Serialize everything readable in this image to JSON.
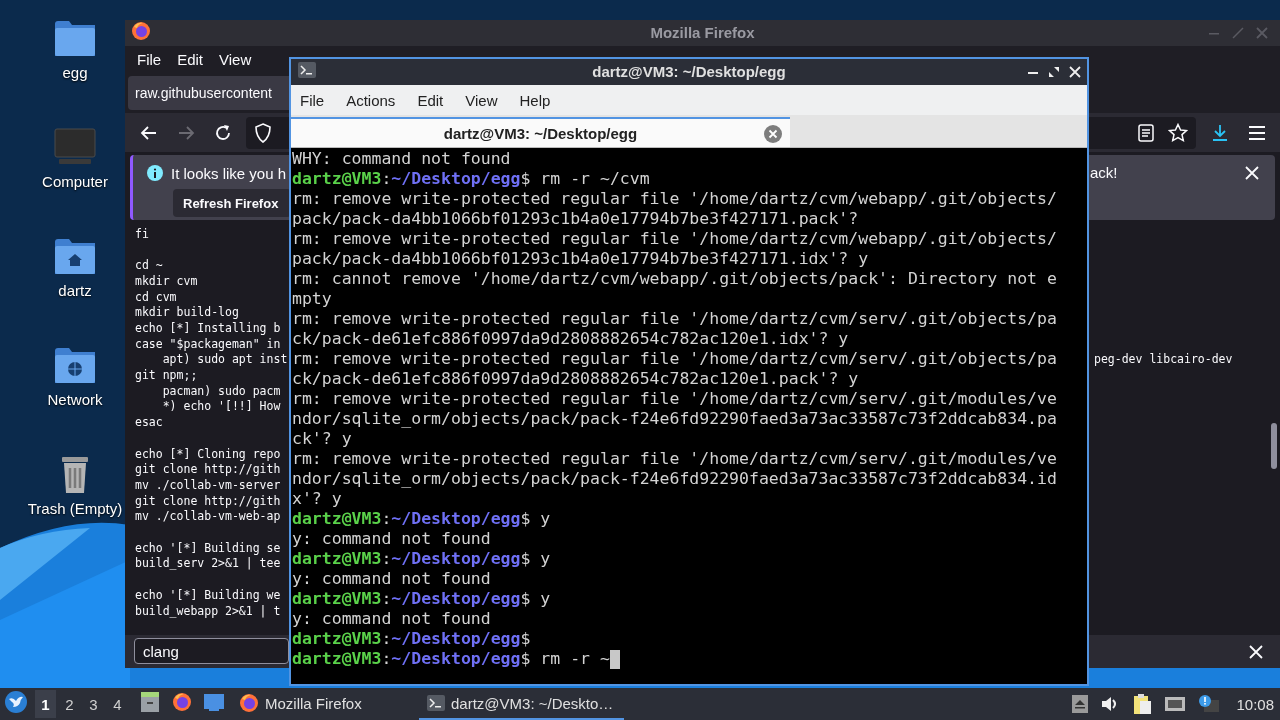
{
  "desktop_icons": [
    {
      "label": "egg",
      "kind": "folder"
    },
    {
      "label": "Computer",
      "kind": "computer"
    },
    {
      "label": "dartz",
      "kind": "home"
    },
    {
      "label": "Network",
      "kind": "network"
    },
    {
      "label": "Trash (Empty)",
      "kind": "trash"
    }
  ],
  "firefox": {
    "title": "Mozilla Firefox",
    "menu": [
      "File",
      "Edit",
      "View"
    ],
    "tab": {
      "label": "raw.githubusercontent"
    },
    "notification": {
      "message": "It looks like you h",
      "message_end": "ack!",
      "button": "Refresh Firefox"
    },
    "code_blocks": [
      [
        "fi"
      ],
      [
        "cd ~",
        "mkdir cvm",
        "cd cvm",
        "mkdir build-log",
        "echo [*] Installing b",
        "case \"$packageman\" in",
        "    apt) sudo apt inst",
        "git npm;;",
        "    pacman) sudo pacm",
        "    *) echo '[!!] How",
        "esac"
      ],
      [
        "echo [*] Cloning repo",
        "git clone http://gith",
        "mv ./collab-vm-server",
        "git clone http://gith",
        "mv ./collab-vm-web-ap"
      ],
      [
        "echo '[*] Building se",
        "build_serv 2>&1 | tee"
      ],
      [
        "echo '[*] Building we",
        "build_webapp 2>&1 | t"
      ]
    ],
    "code_fragment": "peg-dev libcairo-dev",
    "find": {
      "value": "clang"
    }
  },
  "terminal": {
    "title": "dartz@VM3: ~/Desktop/egg",
    "menu": [
      "File",
      "Actions",
      "Edit",
      "View",
      "Help"
    ],
    "tab": {
      "label": "dartz@VM3: ~/Desktop/egg",
      "selected": true
    },
    "cursor": true,
    "lines": [
      {
        "segments": [
          {
            "kind": "plain",
            "text": "WHY: command not found"
          }
        ]
      },
      {
        "segments": [
          {
            "kind": "user",
            "text": "dartz@VM3"
          },
          {
            "kind": "plain",
            "text": ":"
          },
          {
            "kind": "path",
            "text": "~/Desktop/egg"
          },
          {
            "kind": "plain",
            "text": "$ rm -r ~/cvm"
          }
        ]
      },
      {
        "segments": [
          {
            "kind": "plain",
            "text": "rm: remove write-protected regular file '/home/dartz/cvm/webapp/.git/objects/"
          }
        ]
      },
      {
        "segments": [
          {
            "kind": "plain",
            "text": "pack/pack-da4bb1066bf01293c1b4a0e17794b7be3f427171.pack'?"
          }
        ]
      },
      {
        "segments": [
          {
            "kind": "plain",
            "text": "rm: remove write-protected regular file '/home/dartz/cvm/webapp/.git/objects/"
          }
        ]
      },
      {
        "segments": [
          {
            "kind": "plain",
            "text": "pack/pack-da4bb1066bf01293c1b4a0e17794b7be3f427171.idx'? y"
          }
        ]
      },
      {
        "segments": [
          {
            "kind": "plain",
            "text": "rm: cannot remove '/home/dartz/cvm/webapp/.git/objects/pack': Directory not e"
          }
        ]
      },
      {
        "segments": [
          {
            "kind": "plain",
            "text": "mpty"
          }
        ]
      },
      {
        "segments": [
          {
            "kind": "plain",
            "text": "rm: remove write-protected regular file '/home/dartz/cvm/serv/.git/objects/pa"
          }
        ]
      },
      {
        "segments": [
          {
            "kind": "plain",
            "text": "ck/pack-de61efc886f0997da9d2808882654c782ac120e1.idx'? y"
          }
        ]
      },
      {
        "segments": [
          {
            "kind": "plain",
            "text": "rm: remove write-protected regular file '/home/dartz/cvm/serv/.git/objects/pa"
          }
        ]
      },
      {
        "segments": [
          {
            "kind": "plain",
            "text": "ck/pack-de61efc886f0997da9d2808882654c782ac120e1.pack'? y"
          }
        ]
      },
      {
        "segments": [
          {
            "kind": "plain",
            "text": "rm: remove write-protected regular file '/home/dartz/cvm/serv/.git/modules/ve"
          }
        ]
      },
      {
        "segments": [
          {
            "kind": "plain",
            "text": "ndor/sqlite_orm/objects/pack/pack-f24e6fd92290faed3a73ac33587c73f2ddcab834.pa"
          }
        ]
      },
      {
        "segments": [
          {
            "kind": "plain",
            "text": "ck'? y"
          }
        ]
      },
      {
        "segments": [
          {
            "kind": "plain",
            "text": "rm: remove write-protected regular file '/home/dartz/cvm/serv/.git/modules/ve"
          }
        ]
      },
      {
        "segments": [
          {
            "kind": "plain",
            "text": "ndor/sqlite_orm/objects/pack/pack-f24e6fd92290faed3a73ac33587c73f2ddcab834.id"
          }
        ]
      },
      {
        "segments": [
          {
            "kind": "plain",
            "text": "x'? y"
          }
        ]
      },
      {
        "segments": [
          {
            "kind": "user",
            "text": "dartz@VM3"
          },
          {
            "kind": "plain",
            "text": ":"
          },
          {
            "kind": "path",
            "text": "~/Desktop/egg"
          },
          {
            "kind": "plain",
            "text": "$ y"
          }
        ]
      },
      {
        "segments": [
          {
            "kind": "plain",
            "text": "y: command not found"
          }
        ]
      },
      {
        "segments": [
          {
            "kind": "user",
            "text": "dartz@VM3"
          },
          {
            "kind": "plain",
            "text": ":"
          },
          {
            "kind": "path",
            "text": "~/Desktop/egg"
          },
          {
            "kind": "plain",
            "text": "$ y"
          }
        ]
      },
      {
        "segments": [
          {
            "kind": "plain",
            "text": "y: command not found"
          }
        ]
      },
      {
        "segments": [
          {
            "kind": "user",
            "text": "dartz@VM3"
          },
          {
            "kind": "plain",
            "text": ":"
          },
          {
            "kind": "path",
            "text": "~/Desktop/egg"
          },
          {
            "kind": "plain",
            "text": "$ y"
          }
        ]
      },
      {
        "segments": [
          {
            "kind": "plain",
            "text": "y: command not found"
          }
        ]
      },
      {
        "segments": [
          {
            "kind": "user",
            "text": "dartz@VM3"
          },
          {
            "kind": "plain",
            "text": ":"
          },
          {
            "kind": "path",
            "text": "~/Desktop/egg"
          },
          {
            "kind": "plain",
            "text": "$"
          }
        ]
      },
      {
        "segments": [
          {
            "kind": "user",
            "text": "dartz@VM3"
          },
          {
            "kind": "plain",
            "text": ":"
          },
          {
            "kind": "path",
            "text": "~/Desktop/egg"
          },
          {
            "kind": "plain",
            "text": "$ rm -r ~"
          }
        ]
      }
    ]
  },
  "taskbar": {
    "workspaces": [
      {
        "label": "1",
        "selected": true
      },
      {
        "label": "2",
        "selected": false
      },
      {
        "label": "3",
        "selected": false
      },
      {
        "label": "4",
        "selected": false
      }
    ],
    "tasks": [
      {
        "label": "Mozilla Firefox",
        "kind": "firefox",
        "selected": false
      },
      {
        "label": "dartz@VM3: ~/Deskto…",
        "kind": "terminal",
        "selected": true
      }
    ],
    "clock": "10:08"
  }
}
